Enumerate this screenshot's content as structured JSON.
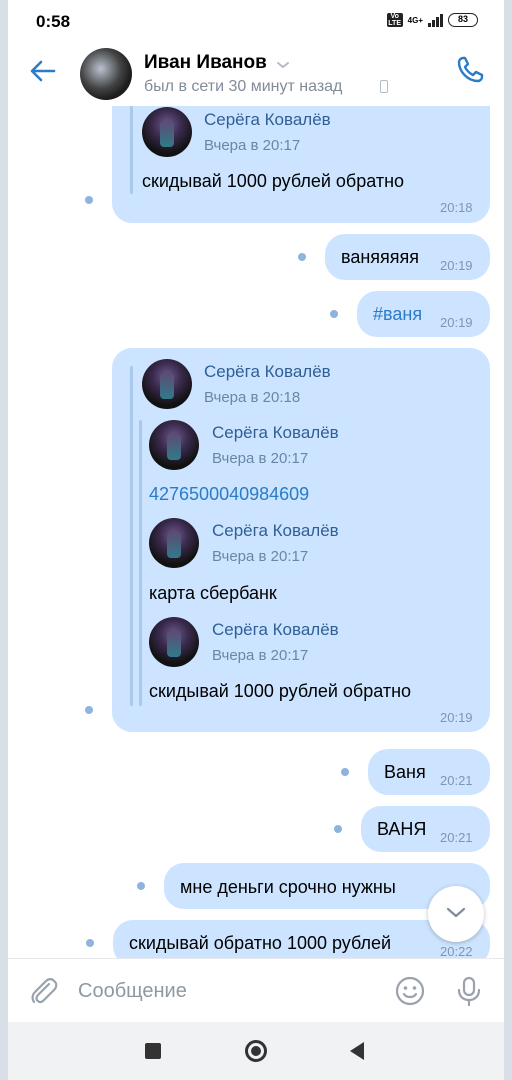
{
  "status_bar": {
    "time": "0:58",
    "volte": "VoLTE",
    "network": "4G+",
    "battery": "83"
  },
  "header": {
    "contact_name": "Иван Иванов",
    "last_seen": "был в сети 30 минут назад"
  },
  "messages": [
    {
      "direction": "incoming",
      "forwarded": [
        {
          "author": "Серёга Ковалёв",
          "time": "Вчера в 20:17"
        }
      ],
      "text": "скидывай 1000 рублей обратно",
      "time": "20:18"
    },
    {
      "direction": "outgoing",
      "text": "ваняяяяя",
      "time": "20:19"
    },
    {
      "direction": "outgoing",
      "text": "#ваня",
      "time": "20:19"
    },
    {
      "direction": "incoming",
      "forward_outer": {
        "author": "Серёга Ковалёв",
        "time": "Вчера в 20:18"
      },
      "forwarded": [
        {
          "author": "Серёга Ковалёв",
          "time": "Вчера в 20:17",
          "text": "4276500040984609"
        },
        {
          "author": "Серёга Ковалёв",
          "time": "Вчера в 20:17",
          "text": "карта сбербанк"
        },
        {
          "author": "Серёга Ковалёв",
          "time": "Вчера в 20:17",
          "text": "скидывай 1000 рублей обратно"
        }
      ],
      "time": "20:19"
    },
    {
      "direction": "outgoing",
      "text": "Ваня",
      "time": "20:21"
    },
    {
      "direction": "outgoing",
      "text": "ВАНЯ",
      "time": "20:21"
    },
    {
      "direction": "outgoing",
      "text": "мне деньги срочно нужны",
      "time": ""
    },
    {
      "direction": "outgoing",
      "text": "скидывай обратно 1000 рублей",
      "time": "20:22"
    }
  ],
  "composer": {
    "placeholder": "Сообщение"
  },
  "colors": {
    "accent": "#2a7bc8",
    "bubble": "#cce4ff",
    "unread_dot": "#8eb3dc",
    "secondary_text": "#818c99"
  },
  "icons": [
    "back-arrow-icon",
    "phone-icon",
    "chevron-down-icon",
    "paperclip-icon",
    "smile-icon",
    "microphone-icon",
    "scroll-down-icon"
  ]
}
